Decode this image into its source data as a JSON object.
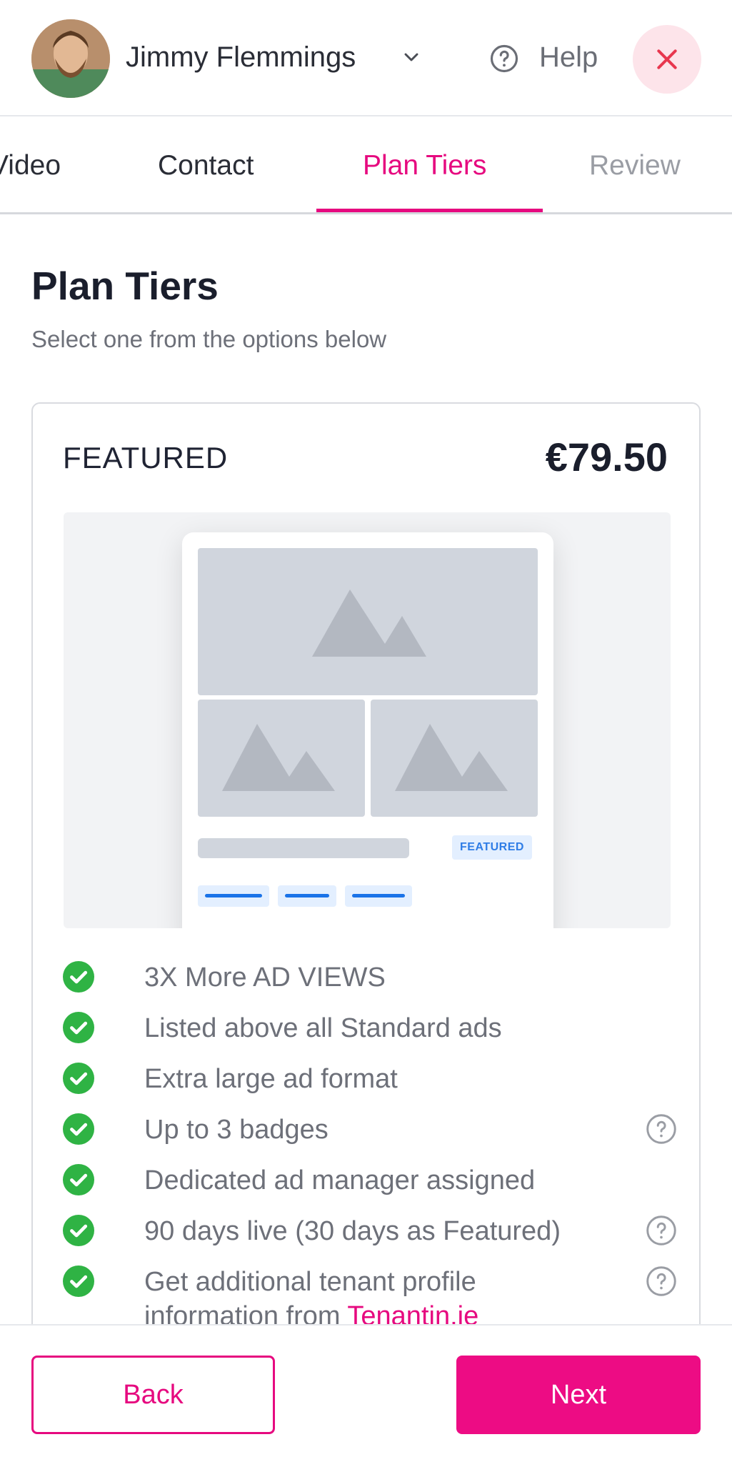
{
  "header": {
    "user_name": "Jimmy Flemmings",
    "help_label": "Help",
    "icons": {
      "user_menu": "chevron-down-icon",
      "help": "question-circle-icon",
      "close": "close-icon"
    },
    "close_bg_color": "#fde4ea"
  },
  "tabs": [
    {
      "label": "Video",
      "state": "done"
    },
    {
      "label": "Contact",
      "state": "done"
    },
    {
      "label": "Plan Tiers",
      "state": "active"
    },
    {
      "label": "Review",
      "state": "upcoming"
    }
  ],
  "main": {
    "title": "Plan Tiers",
    "subtitle": "Select one from the options below"
  },
  "plan": {
    "name": "FEATURED",
    "price": "€79.50",
    "preview_badge": "FEATURED",
    "features": [
      {
        "text": "3X More AD VIEWS",
        "has_info": false
      },
      {
        "text": "Listed above all Standard ads",
        "has_info": false
      },
      {
        "text": "Extra large ad format",
        "has_info": false
      },
      {
        "text": "Up to 3 badges",
        "has_info": true
      },
      {
        "text": "Dedicated ad manager assigned",
        "has_info": false
      },
      {
        "text": "90 days live (30 days as Featured)",
        "has_info": true
      },
      {
        "text": "Get additional tenant profile",
        "text_line2": "information from ",
        "link": "Tenantin.ie",
        "has_info": true
      }
    ]
  },
  "footer": {
    "back_label": "Back",
    "next_label": "Next"
  },
  "colors": {
    "accent": "#e6097f",
    "check": "#2fb344",
    "placeholder": "#d0d5dd"
  }
}
